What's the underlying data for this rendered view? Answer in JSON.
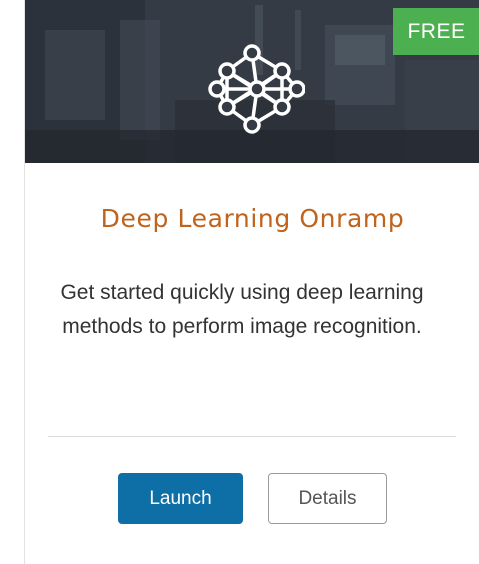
{
  "card": {
    "badge": "FREE",
    "title": "Deep Learning Onramp",
    "description": "Get started quickly using deep learning methods to perform image recognition.",
    "icon": "neural-network-icon",
    "actions": {
      "launch_label": "Launch",
      "details_label": "Details"
    }
  },
  "colors": {
    "title": "#c0631c",
    "badge_background": "#4caf50",
    "launch_background": "#0d6fa5",
    "banner_background": "#2f363f"
  }
}
